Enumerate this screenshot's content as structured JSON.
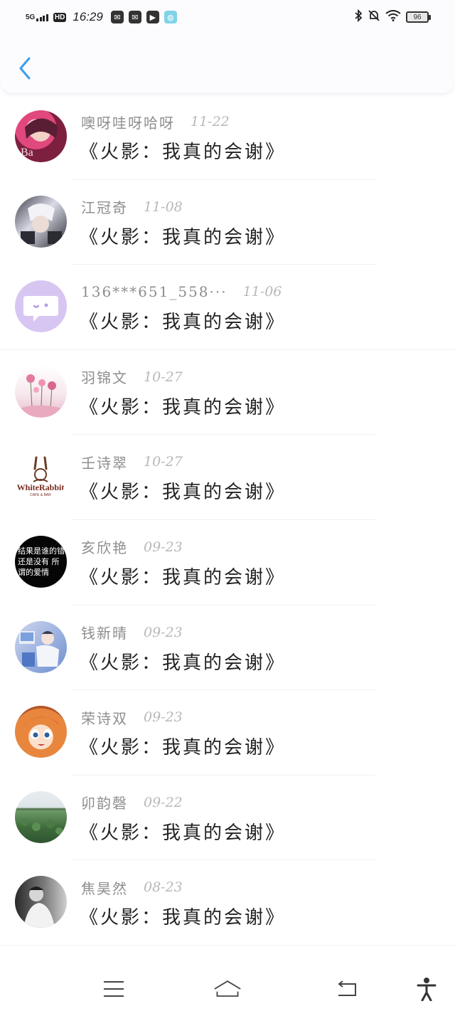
{
  "status_bar": {
    "network": "5G",
    "hd": "HD",
    "time": "16:29",
    "battery": "96"
  },
  "colors": {
    "accent": "#3a9ee8",
    "name_text": "#8e8e8e",
    "date_text": "#b8b8b8",
    "message_text": "#222222"
  },
  "messages": [
    {
      "name": "噢呀哇呀哈呀",
      "date": "11-22",
      "text": "《火影：我真的会谢》",
      "avatar": "anime-girl-pink"
    },
    {
      "name": "江冠奇",
      "date": "11-08",
      "text": "《火影：我真的会谢》",
      "avatar": "anime-boy-white-hair"
    },
    {
      "name": "136***651_558···",
      "date": "11-06",
      "text": "《火影：我真的会谢》",
      "avatar": "chat-bubble-default"
    },
    {
      "name": "羽锦文",
      "date": "10-27",
      "text": "《火影：我真的会谢》",
      "avatar": "pink-flowers"
    },
    {
      "name": "壬诗翠",
      "date": "10-27",
      "text": "《火影：我真的会谢》",
      "avatar": "white-rabbit-logo",
      "avatar_logo": "WhiteRabbit",
      "avatar_sub": "CAFE & BAR"
    },
    {
      "name": "亥欣艳",
      "date": "09-23",
      "text": "《火影：我真的会谢》",
      "avatar": "black-text-card",
      "avatar_text": "结果是谁的错 还是没有 所谓的爱情"
    },
    {
      "name": "钱新晴",
      "date": "09-23",
      "text": "《火影：我真的会谢》",
      "avatar": "illustration-blue"
    },
    {
      "name": "荣诗双",
      "date": "09-23",
      "text": "《火影：我真的会谢》",
      "avatar": "anime-girl-orange-hair"
    },
    {
      "name": "卯韵磬",
      "date": "09-22",
      "text": "《火影：我真的会谢》",
      "avatar": "lotus-pond"
    },
    {
      "name": "焦昊然",
      "date": "08-23",
      "text": "《火影：我真的会谢》",
      "avatar": "bw-portrait"
    }
  ],
  "nav": {
    "menu_icon": "menu-icon",
    "home_icon": "home-icon",
    "back_icon": "return-icon",
    "accessibility_icon": "accessibility-icon"
  }
}
